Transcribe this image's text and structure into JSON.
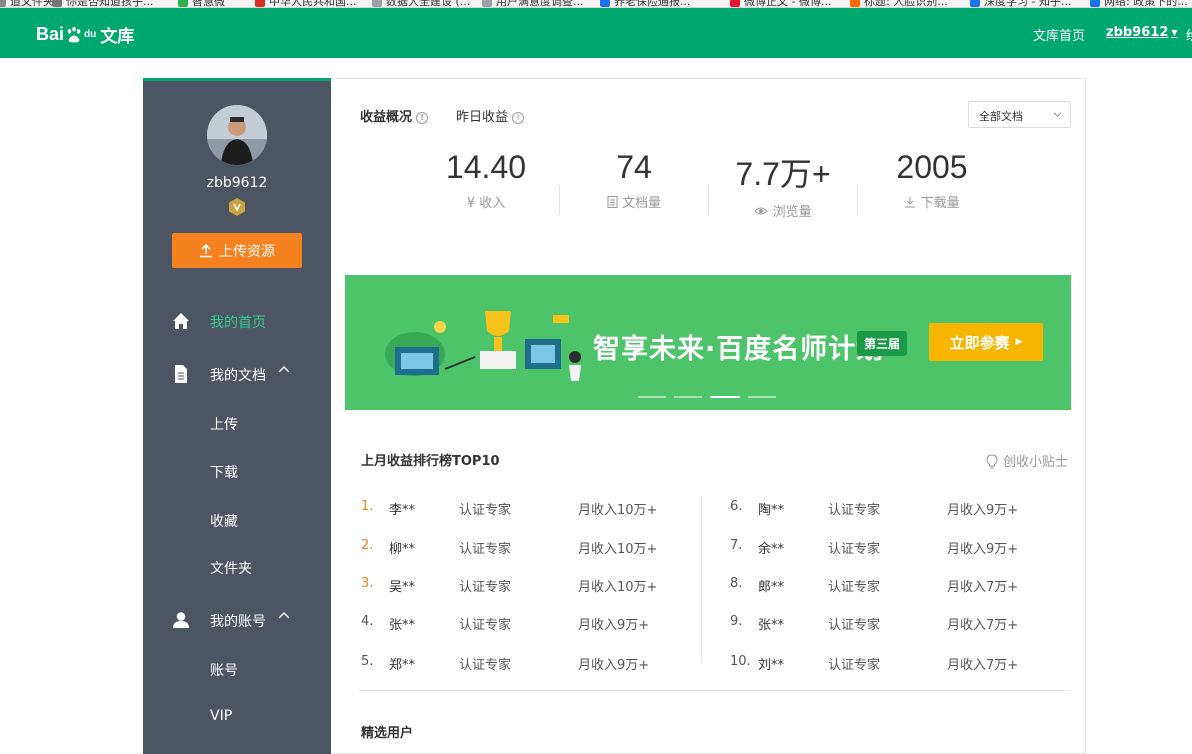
{
  "browser": {
    "bookmarks": [
      {
        "label": "道文件夹",
        "color": "#888888"
      },
      {
        "label": "你是否知道孩子...",
        "color": "#777777"
      },
      {
        "label": "智慧微",
        "color": "#2fb14a"
      },
      {
        "label": "中华人民共和国...",
        "color": "#d93025"
      },
      {
        "label": "数据大全建设 (...",
        "color": "#9aa0a6"
      },
      {
        "label": "用户满意度调查...",
        "color": "#9aa0a6"
      },
      {
        "label": "养老保险通报...",
        "color": "#1a73e8"
      },
      {
        "label": "微博正文 - 微博...",
        "color": "#e6162d"
      },
      {
        "label": "标题: 人脸识别...",
        "color": "#ff6a00"
      },
      {
        "label": "深度学习 - 知乎...",
        "color": "#1a73e8"
      },
      {
        "label": "网络: 政策下的...",
        "color": "#1a73e8"
      }
    ]
  },
  "header": {
    "logo_text": "Bai",
    "logo_du": "du",
    "logo_wk": "文库",
    "nav_home": "文库首页",
    "nav_user": "zbb9612",
    "nav_more": "绘"
  },
  "sidebar": {
    "username": "zbb9612",
    "upload_label": "上传资源",
    "items": [
      {
        "label": "我的首页",
        "icon": "home-icon",
        "active": true
      },
      {
        "label": "我的文档",
        "icon": "document-icon",
        "expanded": true
      },
      {
        "label": "我的账号",
        "icon": "user-icon",
        "expanded": true
      }
    ],
    "docs_sub": [
      "上传",
      "下载",
      "收藏",
      "文件夹"
    ],
    "account_sub": [
      "账号",
      "VIP"
    ]
  },
  "overview": {
    "tab_income": "收益概况",
    "tab_yesterday": "昨日收益",
    "filter_value": "全部文档",
    "stats": [
      {
        "value": "14.40",
        "label": "收入",
        "icon": "yuan-icon"
      },
      {
        "value": "74",
        "label": "文档量",
        "icon": "doc-list-icon"
      },
      {
        "value": "7.7万+",
        "label": "浏览量",
        "icon": "eye-icon"
      },
      {
        "value": "2005",
        "label": "下载量",
        "icon": "download-icon"
      }
    ]
  },
  "banner": {
    "title": "智享未来·百度名师计划",
    "badge": "第三届",
    "cta": "立即参赛",
    "active_slide": 3,
    "slide_count": 4,
    "colors": {
      "bg": "#4dc36a",
      "cta": "#f7b500",
      "badge": "#1a9a46"
    }
  },
  "ranking": {
    "title": "上月收益排行榜TOP10",
    "tips_label": "创收小贴士",
    "rows": [
      {
        "rank": "1.",
        "name": "李**",
        "type": "认证专家",
        "income": "月收入10万+"
      },
      {
        "rank": "2.",
        "name": "柳**",
        "type": "认证专家",
        "income": "月收入10万+"
      },
      {
        "rank": "3.",
        "name": "吴**",
        "type": "认证专家",
        "income": "月收入10万+"
      },
      {
        "rank": "4.",
        "name": "张**",
        "type": "认证专家",
        "income": "月收入9万+"
      },
      {
        "rank": "5.",
        "name": "郑**",
        "type": "认证专家",
        "income": "月收入9万+"
      },
      {
        "rank": "6.",
        "name": "陶**",
        "type": "认证专家",
        "income": "月收入9万+"
      },
      {
        "rank": "7.",
        "name": "余**",
        "type": "认证专家",
        "income": "月收入9万+"
      },
      {
        "rank": "8.",
        "name": "郎**",
        "type": "认证专家",
        "income": "月收入7万+"
      },
      {
        "rank": "9.",
        "name": "张**",
        "type": "认证专家",
        "income": "月收入7万+"
      },
      {
        "rank": "10.",
        "name": "刘**",
        "type": "认证专家",
        "income": "月收入7万+"
      }
    ]
  },
  "featured": {
    "title": "精选用户"
  },
  "colors": {
    "brand": "#00a870",
    "sidebar": "#4c5561",
    "upload": "#f5821f",
    "top3": "#f5821f"
  }
}
